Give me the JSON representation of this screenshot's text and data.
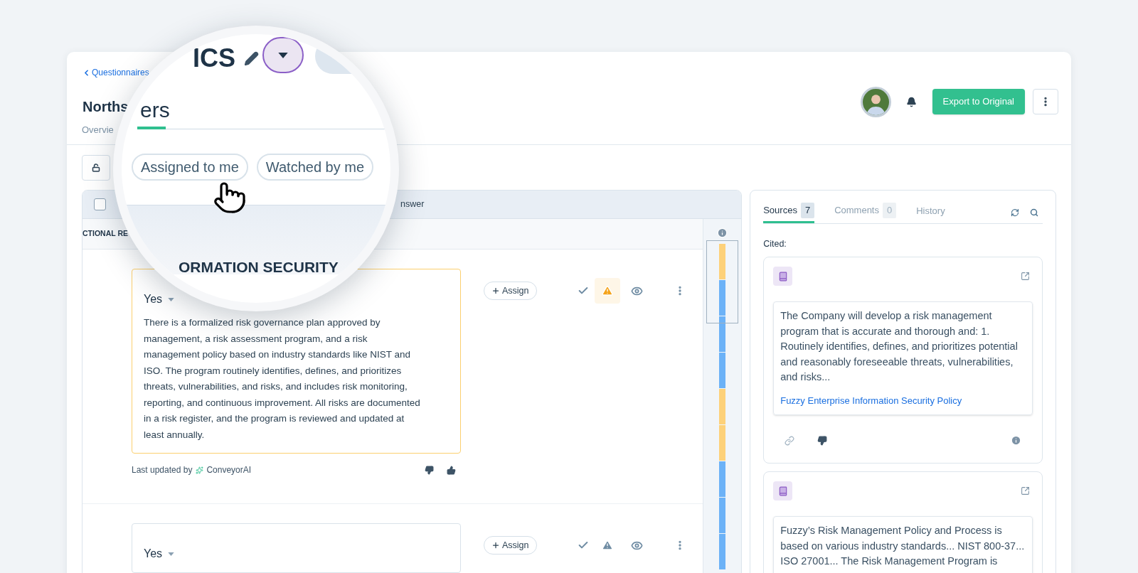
{
  "breadcrumb": "Questionnaires",
  "title": "Norths",
  "export_button": "Export to Original",
  "tabs": [
    {
      "label": "Overvie",
      "selected": false
    }
  ],
  "table": {
    "header": {
      "checked": false,
      "column": "nswer"
    },
    "section": "CTIONAL RE",
    "rows": [
      {
        "answer": "Yes",
        "flagged": true,
        "assign": "Assign",
        "text": "There is a formalized risk governance plan approved by management, a risk assessment program, and a risk management policy based on industry standards like NIST and ISO. The program routinely identifies, defines, and prioritizes threats, vulnerabilities, and risks, and includes risk monitoring, reporting, and continuous improvement. All risks are documented in a risk register, and the program is reviewed and updated at least annually.",
        "footer": {
          "label": "Last updated by",
          "author": "ConveyorAI"
        }
      },
      {
        "answer": "Yes",
        "flagged": false,
        "assign": "Assign"
      }
    ]
  },
  "minimap": [
    {
      "color": "#fdd17a"
    },
    {
      "color": "#6cb2f7"
    },
    {
      "color": "#6cb2f7"
    },
    {
      "color": "#6cb2f7"
    },
    {
      "color": "#fdd17a"
    },
    {
      "color": "#fdd17a"
    },
    {
      "color": "#6cb2f7"
    },
    {
      "color": "#6cb2f7"
    },
    {
      "color": "#6cb2f7"
    }
  ],
  "sidebar": {
    "tabs": [
      {
        "label": "Sources",
        "count": "7",
        "selected": true
      },
      {
        "label": "Comments",
        "count": "0",
        "selected": false
      },
      {
        "label": "History",
        "selected": false
      }
    ],
    "cited_label": "Cited:",
    "sources": [
      {
        "excerpt": "The Company will develop a risk management program that is accurate and thorough and: 1. Routinely identifies, defines, and prioritizes potential and reasonably foreseeable threats, vulnerabilities, and risks...",
        "link": "Fuzzy Enterprise Information Security Policy",
        "actions": true
      },
      {
        "excerpt": "Fuzzy’s Risk Management Policy and Process is based on various industry standards... NIST 800-37... ISO 27001... The Risk Management Program is",
        "actions": false
      }
    ]
  },
  "magnifier": {
    "title": "ICS",
    "tab": "ers",
    "filters": [
      "Assigned to me",
      "Watched by me"
    ],
    "section": "ORMATION SECURITY"
  }
}
